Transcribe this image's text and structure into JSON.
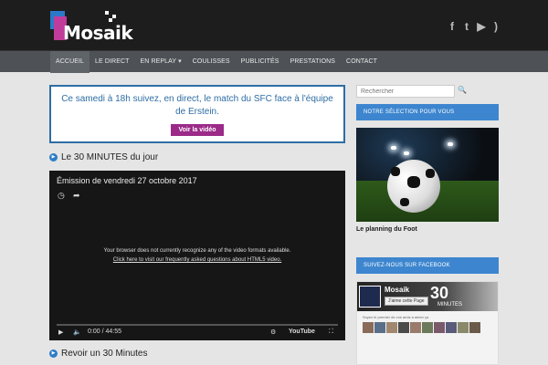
{
  "logo": {
    "text": "Mosaik"
  },
  "social": [
    {
      "icon": "facebook-icon",
      "glyph": "f"
    },
    {
      "icon": "twitter-icon",
      "glyph": "t"
    },
    {
      "icon": "youtube-icon",
      "glyph": "▶"
    },
    {
      "icon": "rss-icon",
      "glyph": ")"
    }
  ],
  "nav": {
    "items": [
      {
        "label": "ACCUEIL",
        "active": true
      },
      {
        "label": "LE DIRECT"
      },
      {
        "label": "EN REPLAY ▾"
      },
      {
        "label": "COULISSES"
      },
      {
        "label": "PUBLICITÉS"
      },
      {
        "label": "PRESTATIONS"
      },
      {
        "label": "CONTACT"
      }
    ]
  },
  "banner": {
    "text": "Ce samedi à 18h suivez, en direct, le match du SFC face à l'équipe de Erstein.",
    "button": "Voir la vidéo"
  },
  "section1": {
    "title": "Le 30 MINUTES du jour"
  },
  "video": {
    "title": "Émission de vendredi 27 octobre 2017",
    "message": "Your browser does not currently recognize any of the video formats available.",
    "link": "Click here to visit our frequently asked questions about HTML5 video.",
    "time": "0:00 / 44:55",
    "brand": "YouTube"
  },
  "section2": {
    "title": "Revoir un 30 Minutes"
  },
  "sidebar": {
    "search_placeholder": "Rechercher",
    "selection_heading": "NOTRE SÉLECTION POUR VOUS",
    "caption": "Le planning du Foot",
    "facebook_heading": "SUIVEZ-NOUS SUR FACEBOOK",
    "fb_name": "Mosaik",
    "fb_like": "J'aime cette Page",
    "fb_big": "30",
    "fb_sub": "MINUTES",
    "fb_text": "Soyez le premier de vos amis à aimer ça"
  },
  "colors": {
    "accent": "#2e6da4",
    "button": "#9b2a88",
    "sidebar_head": "#3d86cf"
  }
}
